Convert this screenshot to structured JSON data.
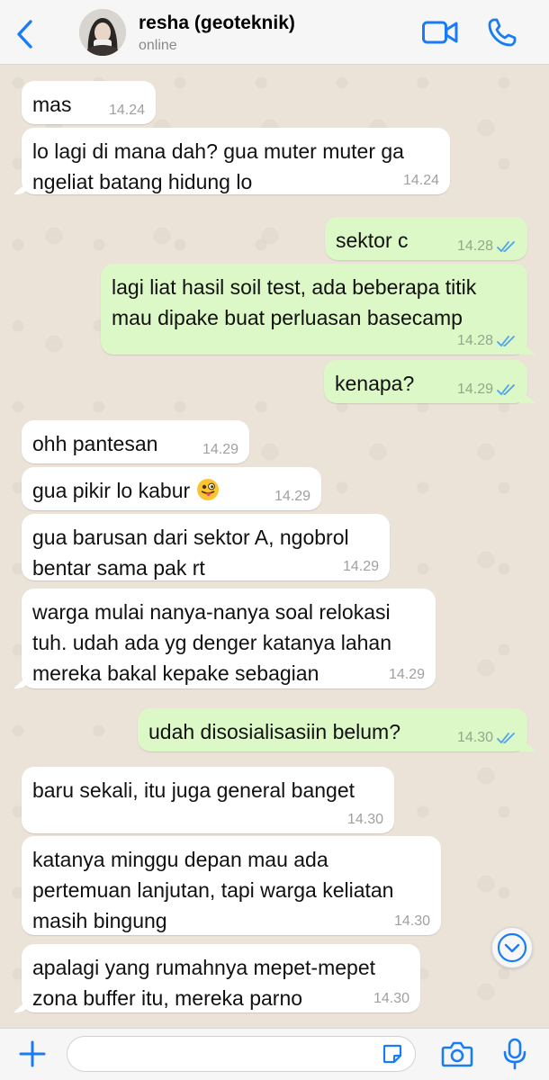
{
  "header": {
    "contact_name": "resha (geoteknik)",
    "status": "online",
    "accent_color": "#1a7cf5"
  },
  "icons": {
    "back": "chevron-left-icon",
    "video": "video-camera-icon",
    "call": "phone-icon",
    "plus": "plus-icon",
    "sticker": "sticker-icon",
    "camera": "camera-icon",
    "mic": "microphone-icon",
    "scroll": "chevron-down-icon",
    "read": "double-check-icon"
  },
  "messages": [
    {
      "dir": "in",
      "text": "mas",
      "time": "14.24"
    },
    {
      "dir": "in",
      "text": "lo lagi di mana dah? gua muter muter ga ngeliat batang hidung lo",
      "time": "14.24"
    },
    {
      "dir": "out",
      "text": "sektor c",
      "time": "14.28",
      "read": true
    },
    {
      "dir": "out",
      "text": "lagi liat hasil soil test, ada beberapa titik mau dipake buat perluasan basecamp",
      "time": "14.28",
      "read": true
    },
    {
      "dir": "out",
      "text": "kenapa?",
      "time": "14.29",
      "read": true
    },
    {
      "dir": "in",
      "text": "ohh pantesan",
      "time": "14.29"
    },
    {
      "dir": "in",
      "text": "gua pikir lo kabur",
      "emoji": "winking face with tongue",
      "time": "14.29"
    },
    {
      "dir": "in",
      "text": "gua barusan dari sektor A, ngobrol bentar sama pak rt",
      "time": "14.29"
    },
    {
      "dir": "in",
      "text": "warga mulai nanya-nanya soal relokasi tuh. udah ada yg denger katanya lahan mereka bakal kepake sebagian",
      "time": "14.29"
    },
    {
      "dir": "out",
      "text": "udah disosialisasiin belum?",
      "time": "14.30",
      "read": true
    },
    {
      "dir": "in",
      "text": "baru sekali, itu juga general banget",
      "time": "14.30"
    },
    {
      "dir": "in",
      "text": "katanya minggu depan mau ada pertemuan lanjutan, tapi warga keliatan masih bingung",
      "time": "14.30"
    },
    {
      "dir": "in",
      "text": "apalagi yang rumahnya mepet-mepet zona buffer itu, mereka parno",
      "time": "14.30"
    }
  ],
  "composer": {
    "placeholder": ""
  }
}
